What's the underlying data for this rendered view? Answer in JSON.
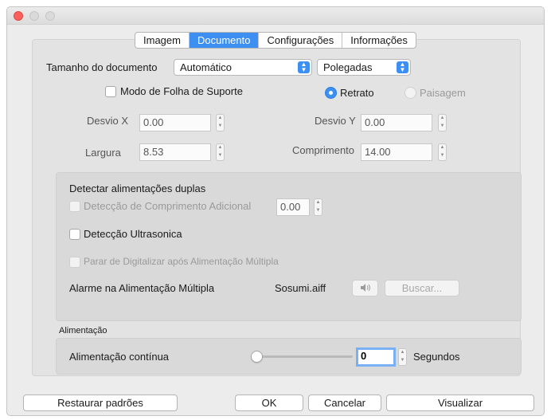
{
  "tabs": [
    {
      "label": "Imagem",
      "active": false
    },
    {
      "label": "Documento",
      "active": true
    },
    {
      "label": "Configurações",
      "active": false
    },
    {
      "label": "Informações",
      "active": false
    }
  ],
  "document": {
    "size_label": "Tamanho do documento",
    "size_value": "Automático",
    "units_value": "Polegadas",
    "carrier_sheet_label": "Modo de Folha de Suporte",
    "carrier_sheet_checked": false,
    "portrait_label": "Retrato",
    "portrait_selected": true,
    "landscape_label": "Paisagem",
    "landscape_selected": false,
    "offset_x_label": "Desvio X",
    "offset_x_value": "0.00",
    "offset_y_label": "Desvio Y",
    "offset_y_value": "0.00",
    "width_label": "Largura",
    "width_value": "8.53",
    "length_label": "Comprimento",
    "length_value": "14.00"
  },
  "double_feed": {
    "title": "Detectar alimentações duplas",
    "length_detect_label": "Detecção de Comprimento Adicional",
    "length_detect_value": "0.00",
    "ultrasonic_label": "Detecção Ultrasonica",
    "stop_scan_label": "Parar de Digitalizar após Alimentação Múltipla",
    "alarm_label": "Alarme na Alimentação Múltipla",
    "alarm_file": "Sosumi.aiff",
    "speaker_icon": "speaker-icon",
    "browse_label": "Buscar..."
  },
  "feeding": {
    "section_label": "Alimentação",
    "continuous_label": "Alimentação contínua",
    "slider_value": 0,
    "seconds_value": "0",
    "seconds_unit": "Segundos"
  },
  "buttons": {
    "restore": "Restaurar padrões",
    "ok": "OK",
    "cancel": "Cancelar",
    "preview": "Visualizar"
  },
  "colors": {
    "accent": "#3d8ff1",
    "close": "#fc605c"
  }
}
